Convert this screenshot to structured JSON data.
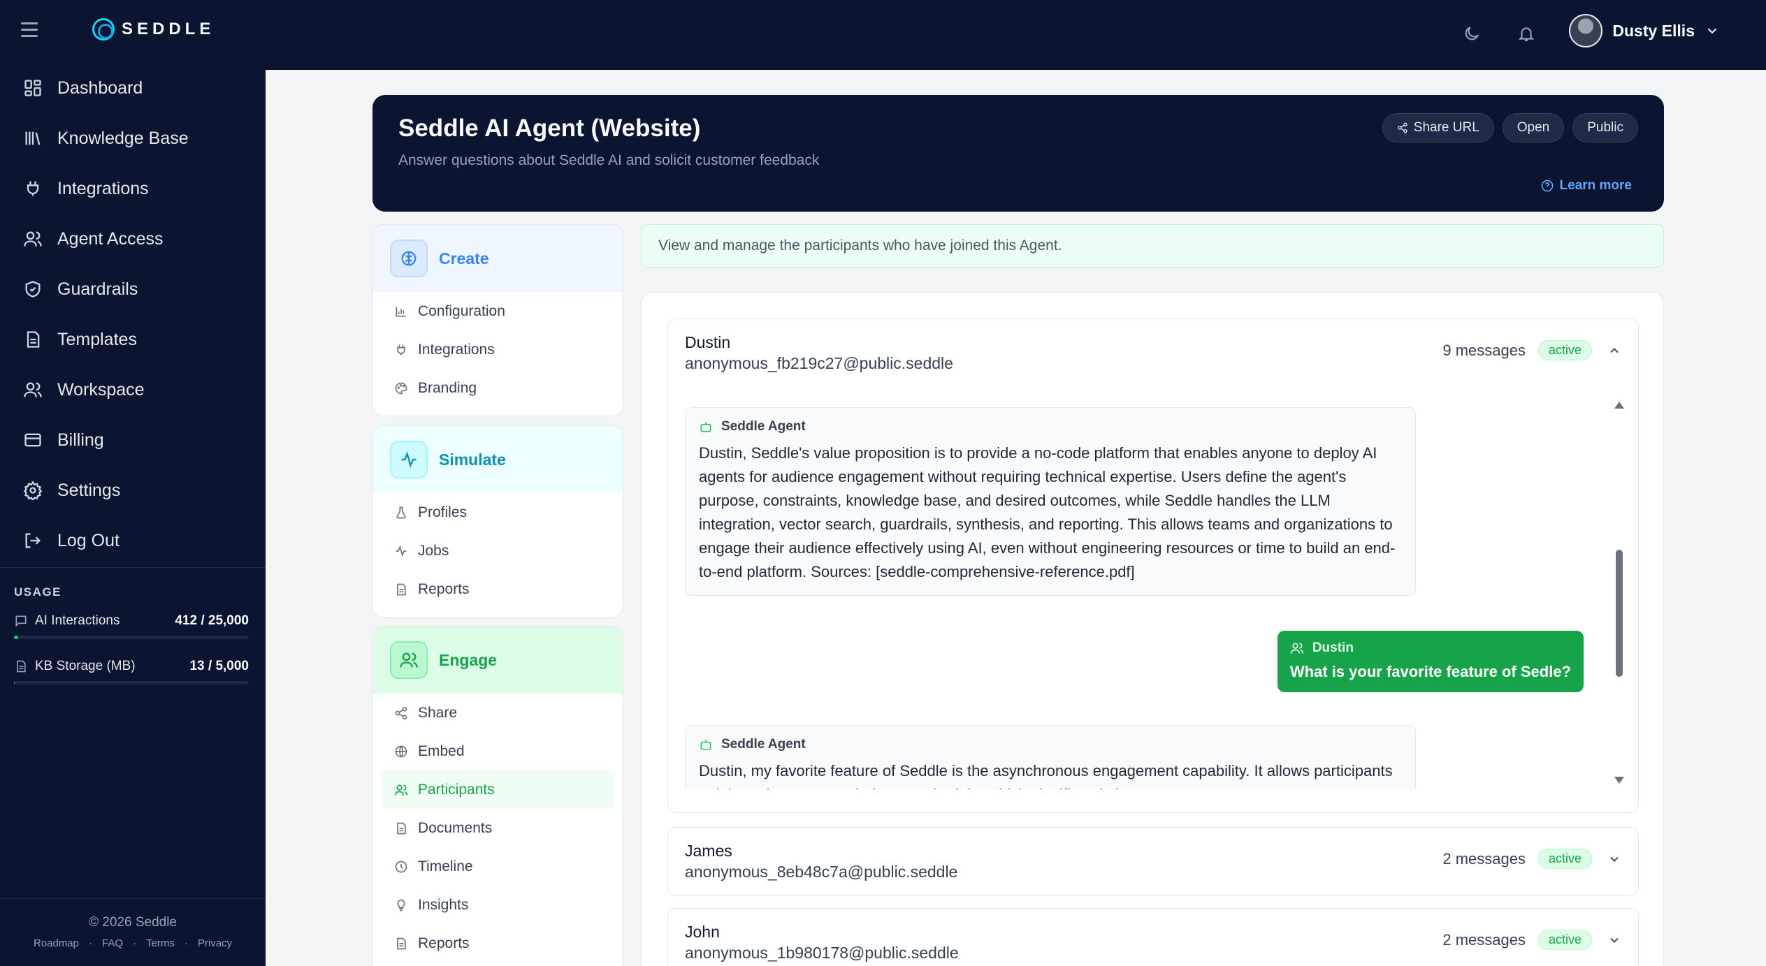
{
  "app": {
    "logo_text": "SEDDLE"
  },
  "sidebar": {
    "items": [
      {
        "label": "Dashboard",
        "icon": "grid-icon"
      },
      {
        "label": "Knowledge Base",
        "icon": "library-icon"
      },
      {
        "label": "Integrations",
        "icon": "plug-icon"
      },
      {
        "label": "Agent Access",
        "icon": "users-icon"
      },
      {
        "label": "Guardrails",
        "icon": "shield-icon"
      },
      {
        "label": "Templates",
        "icon": "document-icon"
      },
      {
        "label": "Workspace",
        "icon": "users-icon"
      },
      {
        "label": "Billing",
        "icon": "credit-card-icon"
      },
      {
        "label": "Settings",
        "icon": "gear-icon"
      },
      {
        "label": "Log Out",
        "icon": "logout-icon"
      }
    ],
    "usage": {
      "title": "USAGE",
      "ai_label": "AI Interactions",
      "ai_value": "412 / 25,000",
      "ai_fraction": 0.0165,
      "kb_label": "KB Storage (MB)",
      "kb_value": "13 / 5,000",
      "kb_fraction": 0.0026
    },
    "footer": {
      "copyright": "© 2026 Seddle",
      "links": [
        "Roadmap",
        "FAQ",
        "Terms",
        "Privacy"
      ],
      "separator": "·"
    }
  },
  "topbar": {
    "user_name": "Dusty Ellis"
  },
  "agent": {
    "title": "Seddle AI Agent (Website)",
    "subtitle": "Answer questions about Seddle AI and solicit customer feedback",
    "share_url": "Share URL",
    "status_open": "Open",
    "visibility": "Public",
    "learn_more": "Learn more"
  },
  "menu": {
    "create": {
      "label": "Create",
      "items": [
        "Configuration",
        "Integrations",
        "Branding"
      ]
    },
    "simulate": {
      "label": "Simulate",
      "items": [
        "Profiles",
        "Jobs",
        "Reports"
      ]
    },
    "engage": {
      "label": "Engage",
      "items": [
        "Share",
        "Embed",
        "Participants",
        "Documents",
        "Timeline",
        "Insights",
        "Reports"
      ]
    }
  },
  "banner": {
    "text": "View and manage the participants who have joined this Agent."
  },
  "participants": [
    {
      "name": "Dustin",
      "email": "anonymous_fb219c27@public.seddle",
      "messages": "9 messages",
      "status": "active",
      "expanded": true
    },
    {
      "name": "James",
      "email": "anonymous_8eb48c7a@public.seddle",
      "messages": "2 messages",
      "status": "active",
      "expanded": false
    },
    {
      "name": "John",
      "email": "anonymous_1b980178@public.seddle",
      "messages": "2 messages",
      "status": "active",
      "expanded": false
    }
  ],
  "chat": {
    "agent_sender": "Seddle Agent",
    "msg1": "Dustin, Seddle's value proposition is to provide a no-code platform that enables anyone to deploy AI agents for audience engagement without requiring technical expertise. Users define the agent's purpose, constraints, knowledge base, and desired outcomes, while Seddle handles the LLM integration, vector search, guardrails, synthesis, and reporting. This allows teams and organizations to engage their audience effectively using AI, even without engineering resources or time to build an end-to-end platform. Sources: [seddle-comprehensive-reference.pdf]",
    "user_sender": "Dustin",
    "msg2": "What is your favorite feature of Sedle?",
    "msg3": "Dustin, my favorite feature of Seddle is the asynchronous engagement capability. It allows participants to join and engage on their own schedule, which significantly increases"
  }
}
